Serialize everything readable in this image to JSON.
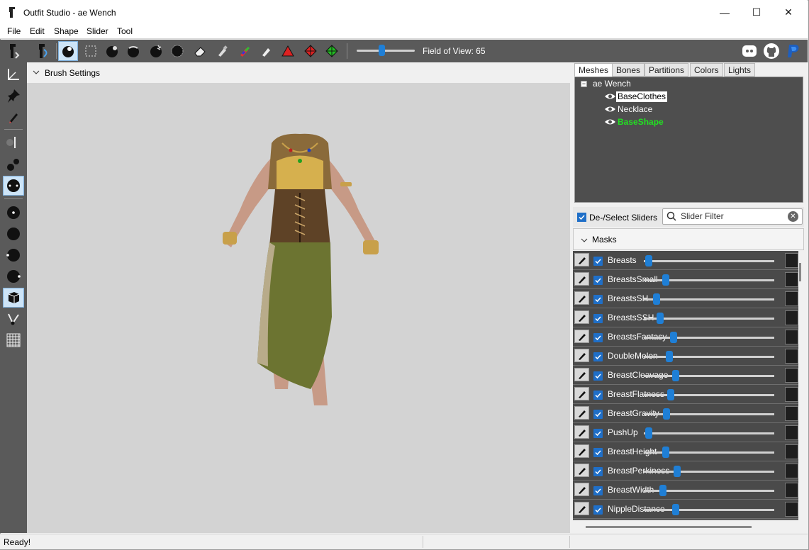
{
  "window": {
    "title": "Outfit Studio - ae Wench",
    "minimize": "—",
    "maximize": "☐",
    "close": "✕"
  },
  "menu": [
    "File",
    "Edit",
    "Shape",
    "Slider",
    "Tool"
  ],
  "toolbar": {
    "fov_label": "Field of View: 65",
    "fov_value": 65
  },
  "brush_settings": {
    "label": "Brush Settings"
  },
  "tabs": [
    "Meshes",
    "Bones",
    "Partitions",
    "Colors",
    "Lights"
  ],
  "meshes": {
    "project": "ae Wench",
    "items": [
      "BaseClothes",
      "Necklace",
      "BaseShape"
    ]
  },
  "filter": {
    "deselect_label": "De-/Select Sliders",
    "placeholder": "Slider Filter"
  },
  "masks_label": "Masks",
  "sliders": [
    {
      "name": "Breasts",
      "value": 0.02
    },
    {
      "name": "BreastsSmall",
      "value": 0.15
    },
    {
      "name": "BreastsSH",
      "value": 0.08
    },
    {
      "name": "BreastsSSH",
      "value": 0.11
    },
    {
      "name": "BreastsFantasy",
      "value": 0.21
    },
    {
      "name": "DoubleMelon",
      "value": 0.18
    },
    {
      "name": "BreastCleavage",
      "value": 0.23
    },
    {
      "name": "BreastFlatness",
      "value": 0.19
    },
    {
      "name": "BreastGravity",
      "value": 0.16
    },
    {
      "name": "PushUp",
      "value": 0.02
    },
    {
      "name": "BreastHeight",
      "value": 0.15
    },
    {
      "name": "BreastPerkiness",
      "value": 0.24
    },
    {
      "name": "BreastWidth",
      "value": 0.13
    },
    {
      "name": "NippleDistance",
      "value": 0.23
    }
  ],
  "status": {
    "text": "Ready!"
  },
  "colors": {
    "toolbar_bg": "#5a5a5a",
    "viewport_bg": "#d3d3d3",
    "slider_thumb": "#1f7fd6",
    "accent_green": "#22e022"
  }
}
